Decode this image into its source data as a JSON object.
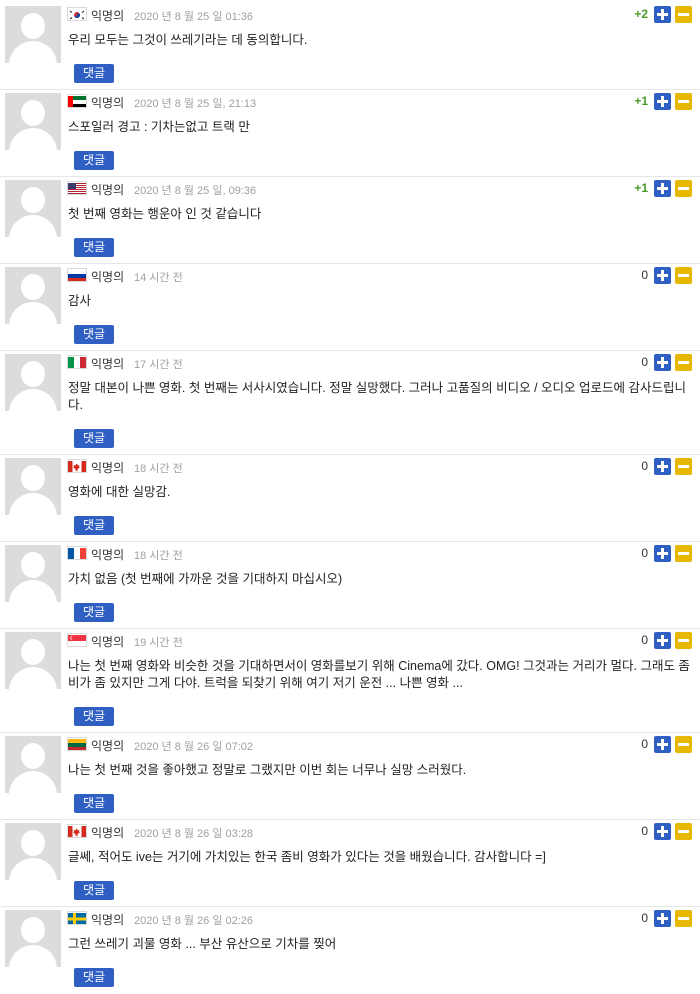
{
  "reply_label": "댓글",
  "comments": [
    {
      "flag": "kr",
      "author": "익명의",
      "date": "2020 년 8 월 25 일 01:36",
      "score": "+2",
      "text": "우리 모두는 그것이 쓰레기라는 데 동의합니다."
    },
    {
      "flag": "ae",
      "author": "익명의",
      "date": "2020 년 8 월 25 일, 21:13",
      "score": "+1",
      "text": "스포일러 경고 : 기차는없고 트랙 만"
    },
    {
      "flag": "us",
      "author": "익명의",
      "date": "2020 년 8 월 25 일, 09:36",
      "score": "+1",
      "text": "첫 번째 영화는 행운아 인 것 같습니다"
    },
    {
      "flag": "ru",
      "author": "익명의",
      "date": "14 시간 전",
      "score": "0",
      "text": "감사"
    },
    {
      "flag": "it",
      "author": "익명의",
      "date": "17 시간 전",
      "score": "0",
      "text": "정말 대본이 나쁜 영화. 첫 번째는 서사시였습니다. 정말 실망했다. 그러나 고품질의 비디오 / 오디오 업로드에 감사드립니다."
    },
    {
      "flag": "ca",
      "author": "익명의",
      "date": "18 시간 전",
      "score": "0",
      "text": "영화에 대한 실망감."
    },
    {
      "flag": "fr",
      "author": "익명의",
      "date": "18 시간 전",
      "score": "0",
      "text": "가치 없음 (첫 번째에 가까운 것을 기대하지 마십시오)"
    },
    {
      "flag": "sg",
      "author": "익명의",
      "date": "19 시간 전",
      "score": "0",
      "text": "나는 첫 번째 영화와 비슷한 것을 기대하면서이 영화를보기 위해 Cinema에 갔다. OMG! 그것과는 거리가 멀다. 그래도 좀비가 좀 있지만 그게 다야. 트럭을 되찾기 위해 여기 저기 운전 ... 나쁜 영화 ..."
    },
    {
      "flag": "lt",
      "author": "익명의",
      "date": "2020 년 8 월 26 일 07:02",
      "score": "0",
      "text": "나는 첫 번째 것을 좋아했고 정말로 그랬지만 이번 회는 너무나 실망 스러웠다."
    },
    {
      "flag": "ca",
      "author": "익명의",
      "date": "2020 년 8 월 26 일 03:28",
      "score": "0",
      "text": "글쎄, 적어도 ive는 거기에 가치있는 한국 좀비 영화가 있다는 것을 배웠습니다. 감사합니다 =]"
    },
    {
      "flag": "se",
      "author": "익명의",
      "date": "2020 년 8 월 26 일 02:26",
      "score": "0",
      "text": "그런 쓰레기 괴물 영화 ... 부산 유산으로 기차를 찢어"
    }
  ]
}
